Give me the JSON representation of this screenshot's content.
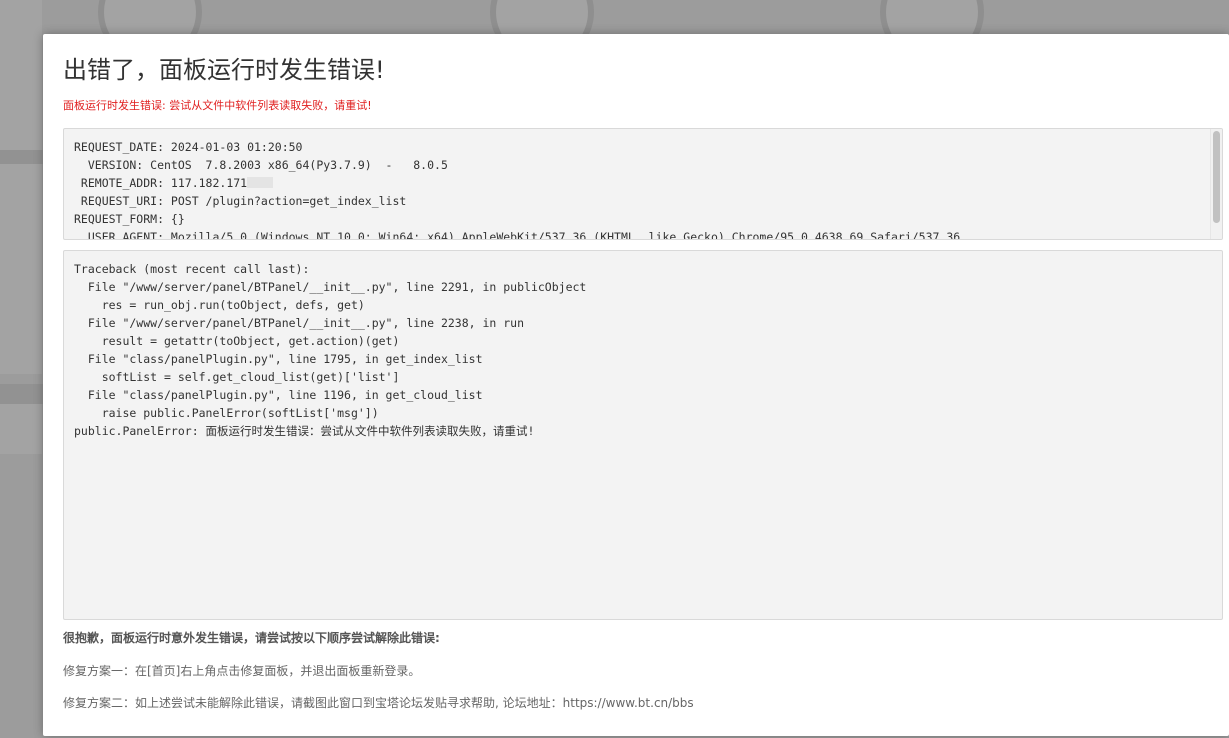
{
  "dialog": {
    "title": "出错了，面板运行时发生错误!",
    "subtitle": "面板运行时发生错误: 尝试从文件中软件列表读取失败，请重试!"
  },
  "request_info": {
    "lines": [
      "REQUEST_DATE: 2024-01-03 01:20:50",
      "  VERSION: CentOS  7.8.2003 x86_64(Py3.7.9)  -   8.0.5",
      " REMOTE_ADDR: 117.182.171",
      " REQUEST_URI: POST /plugin?action=get_index_list",
      "REQUEST_FORM: {}",
      "  USER_AGENT: Mozilla/5.0 (Windows NT 10.0; Win64; x64) AppleWebKit/537.36 (KHTML, like Gecko) Chrome/95.0.4638.69 Safari/537.36"
    ]
  },
  "traceback": {
    "lines": [
      "Traceback (most recent call last):",
      "  File \"/www/server/panel/BTPanel/__init__.py\", line 2291, in publicObject",
      "    res = run_obj.run(toObject, defs, get)",
      "  File \"/www/server/panel/BTPanel/__init__.py\", line 2238, in run",
      "    result = getattr(toObject, get.action)(get)",
      "  File \"class/panelPlugin.py\", line 1795, in get_index_list",
      "    softList = self.get_cloud_list(get)['list']",
      "  File \"class/panelPlugin.py\", line 1196, in get_cloud_list",
      "    raise public.PanelError(softList['msg'])",
      "public.PanelError: 面板运行时发生错误：尝试从文件中软件列表读取失败，请重试!"
    ]
  },
  "help": {
    "heading": "很抱歉，面板运行时意外发生错误，请尝试按以下顺序尝试解除此错误:",
    "fix1": "修复方案一：在[首页]右上角点击修复面板，并退出面板重新登录。",
    "fix2": "修复方案二：如上述尝试未能解除此错误，请截图此窗口到宝塔论坛发贴寻求帮助, 论坛地址：https://www.bt.cn/bbs"
  }
}
